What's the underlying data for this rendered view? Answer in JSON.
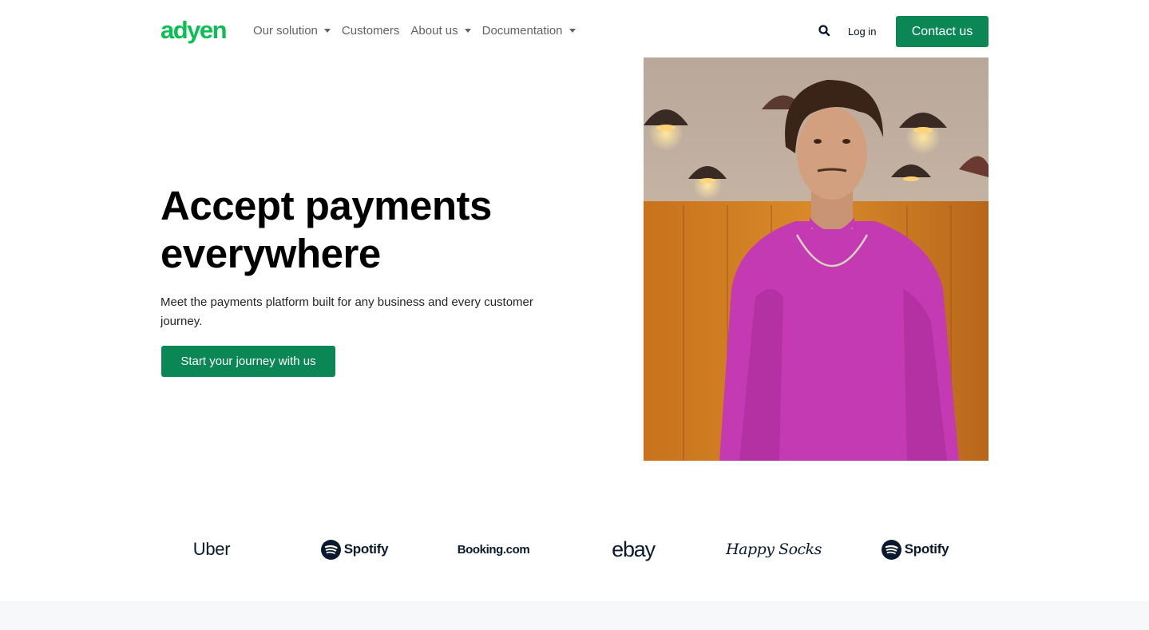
{
  "brand": {
    "logo_text": "adyen",
    "logo_color": "#0abf53"
  },
  "nav": {
    "items": [
      {
        "label": "Our solution",
        "has_dropdown": true
      },
      {
        "label": "Customers",
        "has_dropdown": false
      },
      {
        "label": "About us",
        "has_dropdown": true
      },
      {
        "label": "Documentation",
        "has_dropdown": true
      }
    ],
    "search_icon": "search-icon",
    "login_label": "Log in",
    "contact_label": "Contact us"
  },
  "hero": {
    "title_line1": "Accept payments",
    "title_line2": "everywhere",
    "subtitle": "Meet the payments platform built for any business and every customer journey.",
    "cta_label": "Start your journey with us"
  },
  "customers": [
    {
      "name": "Uber"
    },
    {
      "name": "Spotify"
    },
    {
      "name": "Booking.com"
    },
    {
      "name": "ebay"
    },
    {
      "name": "Happy Socks"
    },
    {
      "name": "Spotify"
    }
  ],
  "colors": {
    "accent": "#0a8754",
    "logo_green": "#0abf53",
    "text_dark": "#00112c"
  }
}
